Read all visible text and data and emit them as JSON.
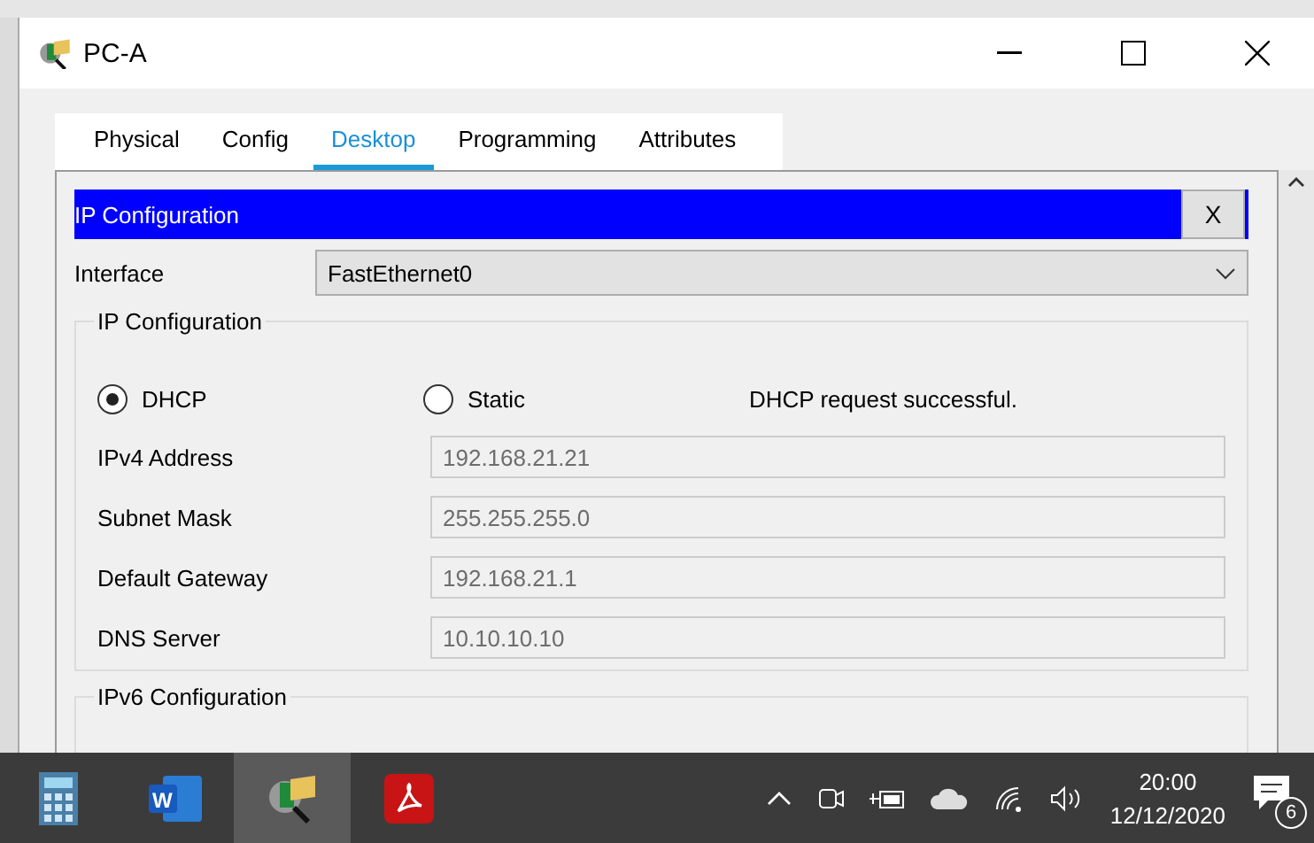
{
  "window": {
    "title": "PC-A"
  },
  "tabs": [
    {
      "label": "Physical",
      "selected": false
    },
    {
      "label": "Config",
      "selected": false
    },
    {
      "label": "Desktop",
      "selected": true
    },
    {
      "label": "Programming",
      "selected": false
    },
    {
      "label": "Attributes",
      "selected": false
    }
  ],
  "panel": {
    "title": "IP Configuration",
    "close": "X",
    "interface_label": "Interface",
    "interface_value": "FastEthernet0"
  },
  "ipv4": {
    "legend": "IP Configuration",
    "modes": [
      {
        "label": "DHCP",
        "selected": true
      },
      {
        "label": "Static",
        "selected": false
      }
    ],
    "status": "DHCP request successful.",
    "fields": [
      {
        "label": "IPv4 Address",
        "value": "192.168.21.21",
        "disabled": true
      },
      {
        "label": "Subnet Mask",
        "value": "255.255.255.0",
        "disabled": true
      },
      {
        "label": "Default Gateway",
        "value": "192.168.21.1",
        "disabled": true
      },
      {
        "label": "DNS Server",
        "value": "10.10.10.10",
        "disabled": true
      }
    ]
  },
  "ipv6": {
    "legend": "IPv6 Configuration"
  },
  "taskbar": {
    "apps": [
      {
        "kind": "calculator",
        "selected": false
      },
      {
        "kind": "word",
        "selected": false,
        "letter": "W"
      },
      {
        "kind": "tracer",
        "selected": true
      },
      {
        "kind": "pdf",
        "selected": false
      }
    ],
    "time": "20:00",
    "date": "12/12/2020",
    "notifications": "6"
  }
}
